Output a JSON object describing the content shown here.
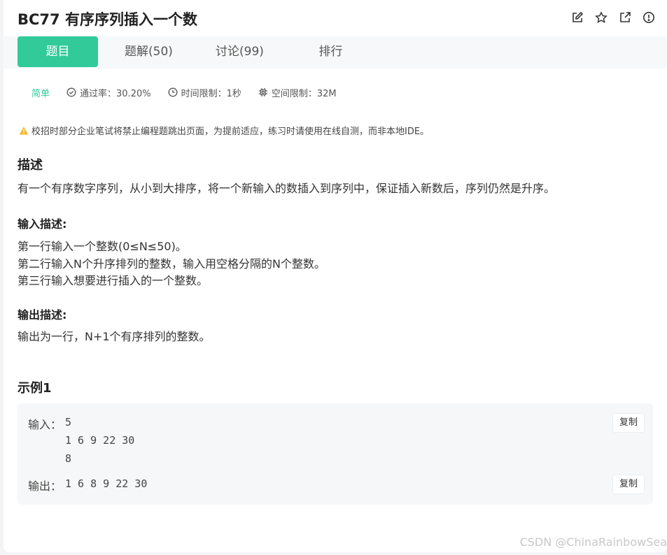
{
  "problem": {
    "title": "BC77  有序序列插入一个数"
  },
  "header_icons": [
    "edit-icon",
    "star-icon",
    "share-icon",
    "report-icon"
  ],
  "tabs": [
    {
      "label": "题目",
      "active": true
    },
    {
      "label": "题解(50)",
      "active": false
    },
    {
      "label": "讨论(99)",
      "active": false
    },
    {
      "label": "排行",
      "active": false
    }
  ],
  "meta": {
    "level": "简单",
    "pass_rate": "通过率：30.20%",
    "time_limit": "时间限制：1秒",
    "space_limit": "空间限制：32M"
  },
  "warning": "校招时部分企业笔试将禁止编程题跳出页面，为提前适应，练习时请使用在线自测，而非本地IDE。",
  "description": {
    "heading": "描述",
    "text": "有一个有序数字序列，从小到大排序，将一个新输入的数插入到序列中，保证插入新数后，序列仍然是升序。"
  },
  "input_desc": {
    "heading": "输入描述:",
    "lines": [
      "第一行输入一个整数(0≤N≤50)。",
      "第二行输入N个升序排列的整数，输入用空格分隔的N个整数。",
      "第三行输入想要进行插入的一个整数。"
    ]
  },
  "output_desc": {
    "heading": "输出描述:",
    "text": "输出为一行，N+1个有序排列的整数。"
  },
  "example": {
    "heading": "示例1",
    "input_label": "输入：",
    "input_lines": [
      "5",
      "1 6 9 22 30",
      "8"
    ],
    "output_label": "输出：",
    "output_value": "1 6 8 9 22 30",
    "copy_label": "复制"
  },
  "watermark": "CSDN @ChinaRainbowSea",
  "colors": {
    "accent": "#32ca99",
    "warning": "#f5b82e"
  }
}
